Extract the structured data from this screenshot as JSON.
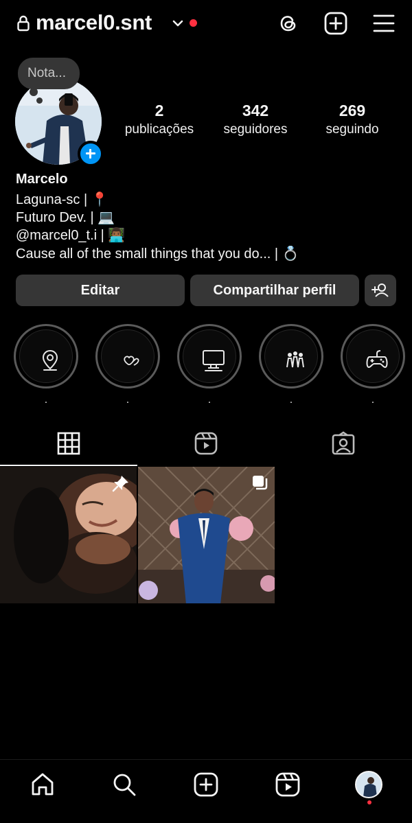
{
  "header": {
    "username": "marcel0.snt"
  },
  "note": {
    "placeholder": "Nota..."
  },
  "stats": [
    {
      "value": "2",
      "label": "publicações"
    },
    {
      "value": "342",
      "label": "seguidores"
    },
    {
      "value": "269",
      "label": "seguindo"
    }
  ],
  "bio": {
    "name": "Marcelo",
    "lines": [
      "Laguna-sc | 📍",
      "Futuro Dev. |  💻",
      "@marcel0_t.i  | 👨🏾‍💻",
      "Cause all of the small things that you do... | 💍"
    ]
  },
  "actions": {
    "edit": "Editar",
    "share": "Compartilhar perfil"
  },
  "highlights": [
    {
      "icon": "location-pin-icon",
      "label": "."
    },
    {
      "icon": "hearts-icon",
      "label": "."
    },
    {
      "icon": "computer-icon",
      "label": "."
    },
    {
      "icon": "friends-group-icon",
      "label": "."
    },
    {
      "icon": "gamepad-icon",
      "label": "."
    }
  ],
  "tabs": [
    {
      "name": "posts-grid",
      "icon": "grid-icon",
      "active": true
    },
    {
      "name": "reels",
      "icon": "reels-icon",
      "active": false
    },
    {
      "name": "tagged",
      "icon": "tagged-person-icon",
      "active": false
    }
  ],
  "posts": [
    {
      "type": "photo",
      "pinned": true,
      "icon": "pin-icon"
    },
    {
      "type": "carousel",
      "pinned": false,
      "icon": "carousel-icon"
    }
  ],
  "nav": [
    {
      "name": "home",
      "icon": "home-icon"
    },
    {
      "name": "search",
      "icon": "search-icon"
    },
    {
      "name": "create",
      "icon": "create-icon"
    },
    {
      "name": "reels",
      "icon": "reels-icon"
    },
    {
      "name": "profile",
      "icon": "avatar"
    }
  ],
  "colors": {
    "background": "#000000",
    "button": "#363636",
    "accent_blue": "#0095f6",
    "notification_red": "#ff3040"
  }
}
